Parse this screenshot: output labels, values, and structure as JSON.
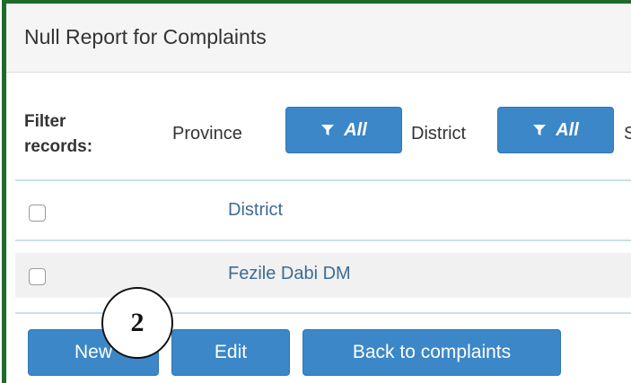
{
  "window": {
    "title": "Null Report for Complaints"
  },
  "filters": {
    "label": "Filter records:",
    "province": {
      "label": "Province",
      "value": "All"
    },
    "district": {
      "label": "District",
      "value": "All"
    },
    "next_label_partial": "S"
  },
  "table": {
    "header": {
      "column": "District"
    },
    "rows": [
      {
        "district": "Fezile Dabi DM"
      }
    ]
  },
  "buttons": {
    "new": "New",
    "edit": "Edit",
    "back": "Back to complaints"
  },
  "annotation": {
    "number": "2"
  },
  "colors": {
    "accent": "#3b87c8",
    "frame": "#1f6b2c",
    "link_text": "#3e6b94"
  },
  "icons": {
    "filter": "funnel-icon"
  }
}
